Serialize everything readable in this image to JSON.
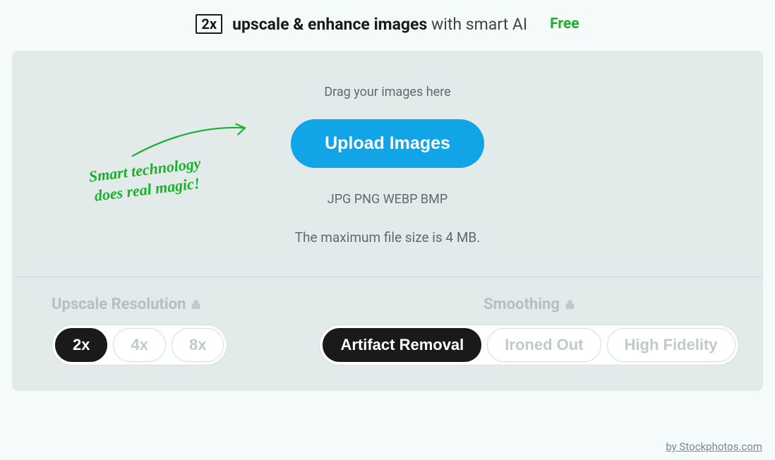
{
  "header": {
    "badge": "2x",
    "title_bold": "upscale & enhance images",
    "title_light": " with smart AI",
    "free_label": "Free"
  },
  "drop": {
    "hint": "Drag your images here",
    "button": "Upload Images",
    "formats": "JPG PNG WEBP BMP",
    "max_size": "The maximum file size is 4 MB."
  },
  "tagline": {
    "line1": "Smart technology",
    "line2": "does real magic!"
  },
  "options": {
    "upscale": {
      "label": "Upscale Resolution",
      "items": [
        "2x",
        "4x",
        "8x"
      ],
      "active": 0
    },
    "smoothing": {
      "label": "Smoothing",
      "items": [
        "Artifact Removal",
        "Ironed Out",
        "High Fidelity"
      ],
      "active": 0
    }
  },
  "footer": {
    "credit": "by Stockphotos.com"
  }
}
